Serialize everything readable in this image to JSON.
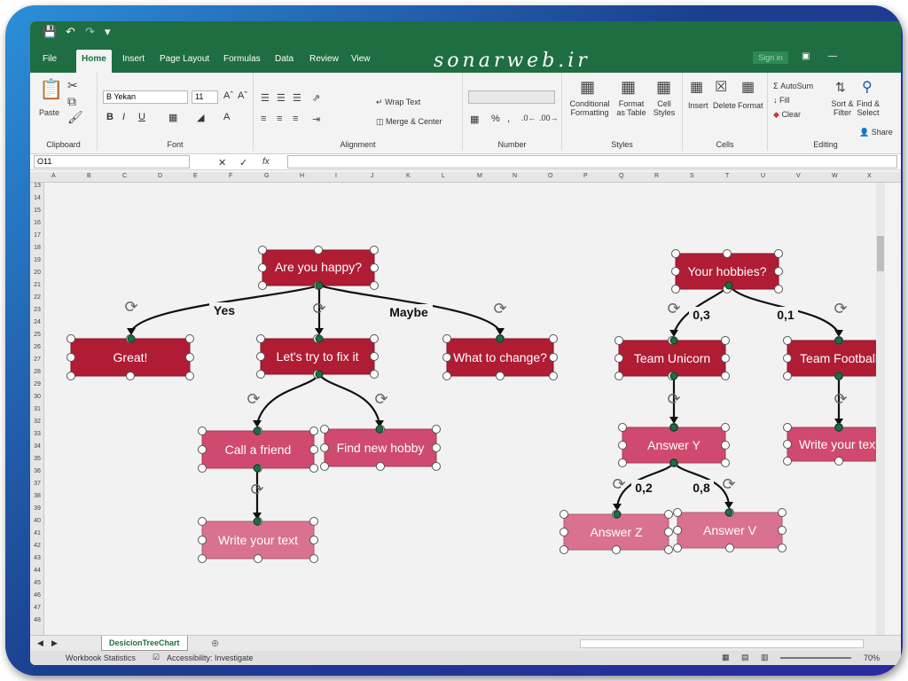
{
  "colors": {
    "excel_green": "#1e6e42",
    "node_dark": "#b01c34",
    "node_mid": "#cf4a6e",
    "node_light": "#d9728f",
    "handle_green": "#1e6e42"
  },
  "titlebar": {
    "watermark": "sonarweb.ir",
    "signin": "Sign in",
    "share": "Share"
  },
  "tabs": [
    "File",
    "Home",
    "Insert",
    "Page Layout",
    "Formulas",
    "Data",
    "Review",
    "View"
  ],
  "ribbon": {
    "clipboard": {
      "paste": "Paste",
      "label": "Clipboard"
    },
    "font": {
      "name": "B Yekan",
      "size": "11",
      "label": "Font"
    },
    "alignment": {
      "wrap": "Wrap Text",
      "merge": "Merge & Center",
      "label": "Alignment"
    },
    "number": {
      "label": "Number",
      "percent": "%"
    },
    "styles": {
      "conditional": "Conditional Formatting",
      "format_table": "Format as Table",
      "cell_styles": "Cell Styles",
      "label": "Styles"
    },
    "cells": {
      "insert": "Insert",
      "delete": "Delete",
      "format": "Format",
      "label": "Cells"
    },
    "editing": {
      "autosum": "AutoSum",
      "fill": "Fill",
      "clear": "Clear",
      "sort": "Sort & Filter",
      "find": "Find & Select",
      "label": "Editing"
    }
  },
  "formula_bar": {
    "name_box": "O11",
    "fx": "fx",
    "value": ""
  },
  "columns": [
    "A",
    "B",
    "C",
    "D",
    "E",
    "F",
    "G",
    "H",
    "I",
    "J",
    "K",
    "L",
    "M",
    "N",
    "O",
    "P",
    "Q",
    "R",
    "S",
    "T",
    "U",
    "V",
    "W",
    "X"
  ],
  "rows": [
    "13",
    "14",
    "15",
    "16",
    "17",
    "18",
    "19",
    "20",
    "21",
    "22",
    "23",
    "24",
    "25",
    "26",
    "27",
    "28",
    "29",
    "30",
    "31",
    "32",
    "33",
    "34",
    "35",
    "36",
    "37",
    "38",
    "39",
    "40",
    "41",
    "42",
    "43",
    "44",
    "45",
    "46",
    "47",
    "48"
  ],
  "diagram": {
    "nodes": {
      "happy": "Are you happy?",
      "great": "Great!",
      "fix": "Let's try to fix it",
      "change": "What to change?",
      "friend": "Call a friend",
      "hobby": "Find new hobby",
      "write1": "Write your text",
      "hobbies": "Your hobbies?",
      "unicorn": "Team Unicorn",
      "football": "Team Football",
      "answer_y": "Answer Y",
      "write2": "Write your text",
      "answer_z": "Answer Z",
      "answer_v": "Answer V"
    },
    "edge_labels": {
      "yes": "Yes",
      "maybe": "Maybe",
      "p03": "0,3",
      "p01": "0,1",
      "p02": "0,2",
      "p08": "0,8"
    }
  },
  "sheet_tab": "DesicionTreeChart",
  "status": {
    "workbook_stats": "Workbook Statistics",
    "accessibility": "Accessibility: Investigate",
    "zoom": "70%"
  }
}
